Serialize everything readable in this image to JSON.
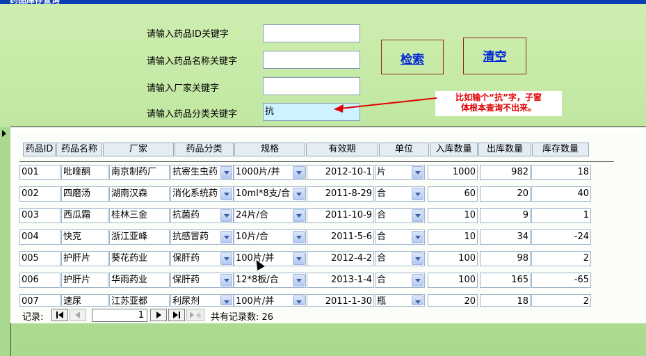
{
  "title": "药品库存查询",
  "search": {
    "id_label": "请输入药品ID关键字",
    "id_value": "",
    "name_label": "请输入药品名称关键字",
    "name_value": "",
    "maker_label": "请输入厂家关键字",
    "maker_value": "",
    "category_label": "请输入药品分类关键字",
    "category_value": "抗",
    "search_button": "检索",
    "clear_button": "清空"
  },
  "annotation": {
    "text_line1": "比如输个“抗”字，子窗",
    "text_line2": "体根本查询不出来。",
    "color": "#e00000"
  },
  "table": {
    "headers": [
      "药品ID",
      "药品名称",
      "厂家",
      "药品分类",
      "规格",
      "有效期",
      "单位",
      "入库数量",
      "出库数量",
      "库存数量"
    ],
    "rows": [
      [
        "001",
        "吡喹酮",
        "南京制药厂",
        "抗寄生虫药",
        "1000片/并",
        "2012-10-1",
        "片",
        "1000",
        "982",
        "18"
      ],
      [
        "002",
        "四磨汤",
        "湖南汉森",
        "消化系统药",
        "10ml*8支/合",
        "2011-8-29",
        "合",
        "60",
        "20",
        "40"
      ],
      [
        "003",
        "西瓜霜",
        "桂林三金",
        "抗菌药",
        "24片/合",
        "2011-10-9",
        "合",
        "10",
        "9",
        "1"
      ],
      [
        "004",
        "快克",
        "浙江亚峰",
        "抗感冒药",
        "10片/合",
        "2011-5-6",
        "合",
        "10",
        "34",
        "-24"
      ],
      [
        "005",
        "护肝片",
        "葵花药业",
        "保肝药",
        "100片/并",
        "2012-4-2",
        "合",
        "100",
        "98",
        "2"
      ],
      [
        "006",
        "护肝片",
        "华雨药业",
        "保肝药",
        "12*8板/合",
        "2013-1-4",
        "合",
        "100",
        "165",
        "-65"
      ],
      [
        "007",
        "速尿",
        "江苏亚都",
        "利尿剂",
        "100片/并",
        "2011-1-30",
        "瓶",
        "20",
        "18",
        "2"
      ]
    ]
  },
  "navigation": {
    "record_label": "记录:",
    "current_record": "1",
    "total_label": "共有记录数: 26"
  }
}
